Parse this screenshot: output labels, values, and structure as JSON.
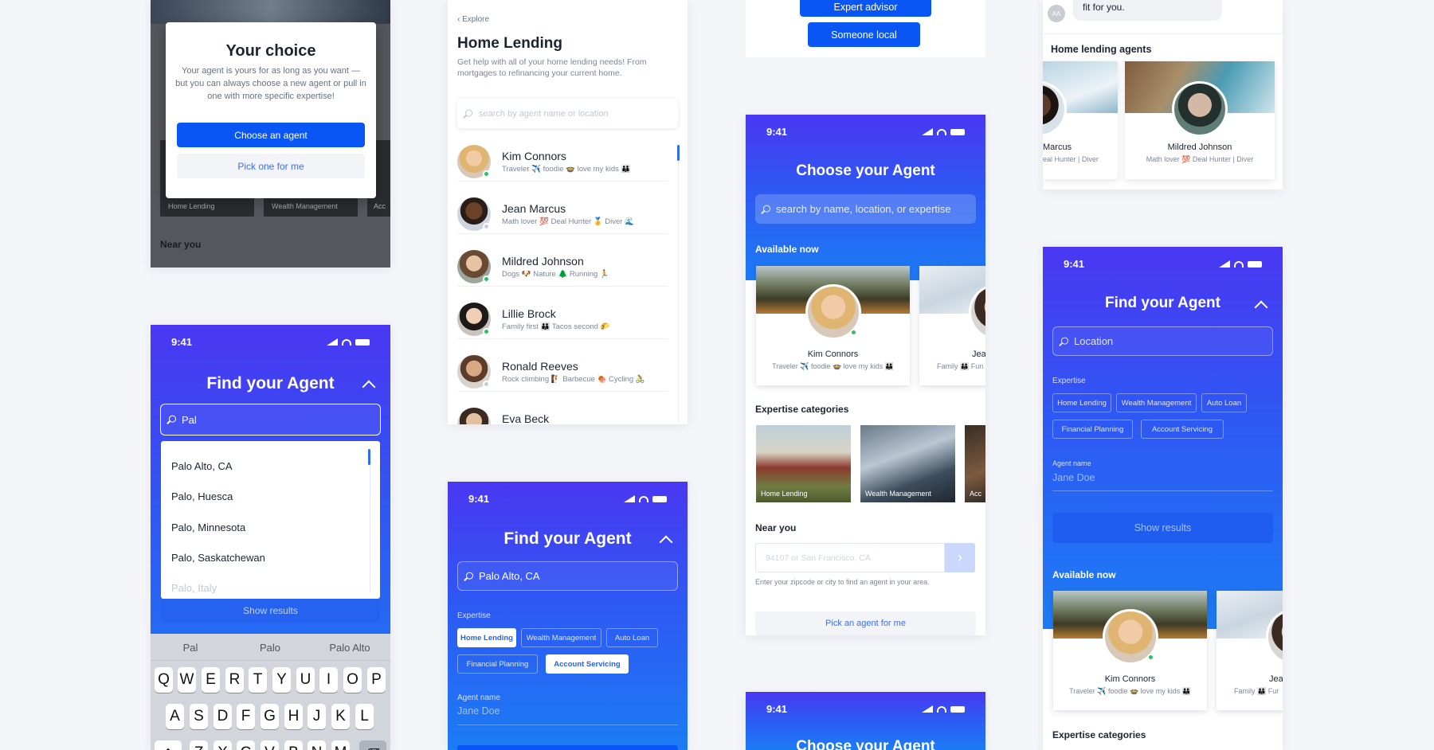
{
  "colors": {
    "accent": "#0a56f5",
    "gradient_top": "#4a37f2",
    "gradient_bottom": "#1c7cf4",
    "online": "#29c16b"
  },
  "status_time": "9:41",
  "choice_modal": {
    "title": "Your choice",
    "body": "Your agent is yours for as long as you want — but you can always choose a new agent or pull in one with more specific expertise!",
    "primary": "Choose an agent",
    "secondary": "Pick one for me",
    "bg_tiles": [
      "Home Lending",
      "Wealth Management",
      "Acc"
    ],
    "near_you": "Near you"
  },
  "search_screen": {
    "title": "Find your Agent",
    "query": "Pal",
    "suggestions": [
      "Palo Alto, CA",
      "Palo, Huesca",
      "Palo, Minnesota",
      "Palo, Saskatchewan",
      "Palo, Italy"
    ],
    "show_results": "Show results",
    "predictions": [
      "Pal",
      "Palo",
      "Palo Alto"
    ],
    "keys_row1": [
      "Q",
      "W",
      "E",
      "R",
      "T",
      "Y",
      "U",
      "I",
      "O",
      "P"
    ],
    "keys_row2": [
      "A",
      "S",
      "D",
      "F",
      "G",
      "H",
      "J",
      "K",
      "L"
    ],
    "keys_row3": [
      "Z",
      "X",
      "C",
      "V",
      "B",
      "N",
      "M"
    ]
  },
  "home_lending": {
    "back": "Explore",
    "title": "Home Lending",
    "desc": "Get help with all of your home lending needs! From mortgages to refinancing your current home.",
    "search_placeholder": "search by agent name or location",
    "agents": [
      {
        "name": "Kim Connors",
        "tags": "Traveler ✈️ foodie 🍲 love my kids 👪"
      },
      {
        "name": "Jean Marcus",
        "tags": "Math lover 💯 Deal Hunter 🏅 Diver 🌊"
      },
      {
        "name": "Mildred Johnson",
        "tags": "Dogs 🐶 Nature 🌲 Running 🏃"
      },
      {
        "name": "Lillie Brock",
        "tags": "Family first 👪 Tacos second 🌮"
      },
      {
        "name": "Ronald Reeves",
        "tags": "Rock climbing 🧗 Barbecue 🍖 Cycling 🚴"
      },
      {
        "name": "Eva Beck",
        "tags": ""
      }
    ]
  },
  "filter_screen": {
    "title": "Find your Agent",
    "location": "Palo Alto, CA",
    "expertise_label": "Expertise",
    "chips": [
      "Home Lending",
      "Wealth Management",
      "Auto Loan",
      "Financial Planning",
      "Account Servicing"
    ],
    "agent_name_label": "Agent name",
    "agent_name_placeholder": "Jane Doe"
  },
  "top_buttons": {
    "expert": "Expert advisor",
    "local": "Someone local"
  },
  "choose_screen": {
    "title": "Choose your Agent",
    "search_placeholder": "search by name, location, or expertise",
    "available_now": "Available now",
    "featured": {
      "name": "Kim Connors",
      "tags": "Traveler ✈️ foodie 🍲 love my kids 👪"
    },
    "partial": {
      "name": "Jea",
      "tags": "Family 👪 Fun"
    },
    "expertise_categories": "Expertise categories",
    "categories": [
      "Home Lending",
      "Wealth Management",
      "Acc"
    ],
    "near_you": "Near you",
    "zip_placeholder": "94107 or San Francisco, CA",
    "zip_help": "Enter your zipcode or city to find an agent in your area.",
    "pick_agent": "Pick an agent for me"
  },
  "bottom_choose": {
    "title": "Choose your Agent"
  },
  "chat_agents": {
    "initials": "AA",
    "bubble": "fit for you.",
    "section": "Home lending agents",
    "agents": [
      {
        "name": "Marcus",
        "tags": "eal Hunter | Diver"
      },
      {
        "name": "Mildred Johnson",
        "tags": "Math lover 💯 Deal Hunter | Diver"
      }
    ]
  },
  "find_full": {
    "title": "Find your Agent",
    "location_placeholder": "Location",
    "expertise_label": "Expertise",
    "chips": [
      "Home Lending",
      "Wealth Management",
      "Auto Loan",
      "Financial Planning",
      "Account Servicing"
    ],
    "agent_name_label": "Agent name",
    "agent_name_placeholder": "Jane Doe",
    "show_results": "Show results",
    "available_now": "Available now",
    "featured": {
      "name": "Kim Connors",
      "tags": "Traveler ✈️ foodie 🍲 love my kids 👪"
    },
    "partial": {
      "name": "Jea",
      "tags": "Family 👪 Fur"
    },
    "expertise_categories": "Expertise categories"
  }
}
